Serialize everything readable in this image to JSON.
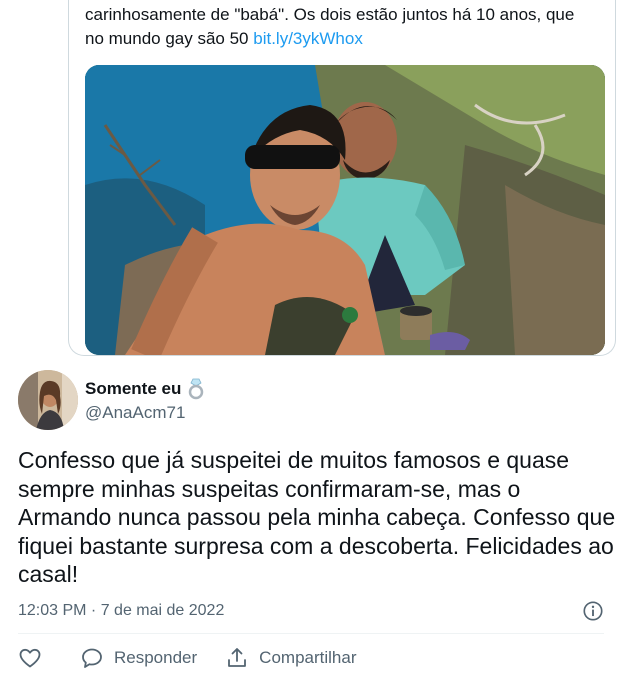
{
  "quoted_tweet": {
    "text_line1": "carinhosamente de \"babá\". Os dois estão juntos há 10 anos, que",
    "text_line2": "no mundo gay são 50 ",
    "link": "bit.ly/3ykWhox"
  },
  "tweet": {
    "display_name": "Somente eu",
    "handle": "@AnaAcm71",
    "text": "Confesso que já suspeitei de muitos famosos e quase sempre minhas suspeitas confirmaram-se, mas o Armando nunca passou pela minha cabeça. Confesso que fiquei bastante surpresa com a descoberta. Felicidades ao casal!",
    "timestamp": "12:03 PM · 7 de mai de 2022"
  },
  "actions": {
    "reply_label": "Responder",
    "share_label": "Compartilhar"
  },
  "icons": {
    "ring": "ring-emoji-icon",
    "info": "info-icon",
    "like": "heart-icon",
    "reply": "speech-bubble-icon",
    "share": "share-upload-icon"
  },
  "colors": {
    "link": "#1d9bf0",
    "secondary_text": "#536471",
    "border": "#cfd9de"
  }
}
